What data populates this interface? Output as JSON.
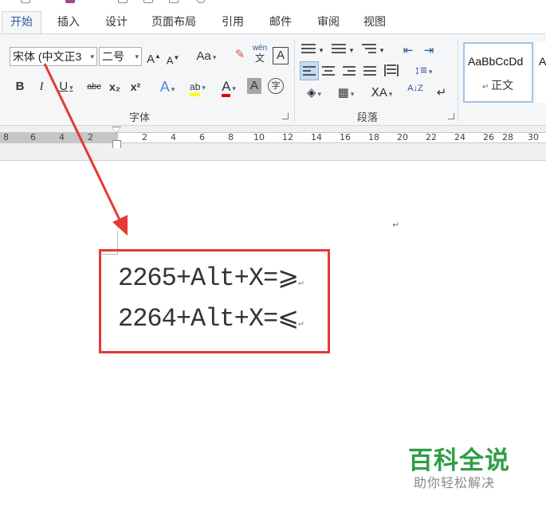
{
  "tabs": [
    {
      "label": "开始",
      "active": true
    },
    {
      "label": "插入"
    },
    {
      "label": "设计"
    },
    {
      "label": "页面布局"
    },
    {
      "label": "引用"
    },
    {
      "label": "邮件"
    },
    {
      "label": "审阅"
    },
    {
      "label": "视图"
    }
  ],
  "font": {
    "name": "宋体 (中文正3",
    "size": "二号",
    "grow_label": "A",
    "shrink_label": "A",
    "case_label": "Aa",
    "phonetic_top": "wén",
    "phonetic_bottom": "文",
    "border_char_label": "A",
    "bold_label": "B",
    "italic_label": "I",
    "underline_label": "U",
    "strike_label": "abc",
    "sub_label": "x₂",
    "sup_label": "x²",
    "effects_label": "A",
    "highlight_label": "ab",
    "color_label": "A",
    "shading_label": "A",
    "enclose_label": "字",
    "group_label": "字体"
  },
  "paragraph": {
    "group_label": "段落",
    "sort_label": "A↓Z"
  },
  "styles": {
    "sample_text": "AaBbCcDd",
    "normal_label": "正文",
    "next_sample": "A"
  },
  "ruler": {
    "ticks": [
      "8",
      "6",
      "4",
      "2",
      "2",
      "4",
      "6",
      "8",
      "10",
      "12",
      "14",
      "16",
      "18",
      "20",
      "22",
      "24",
      "26",
      "28",
      "30"
    ]
  },
  "document": {
    "lines": [
      "2265+Alt+X=⩾",
      "2264+Alt+X=⩽"
    ],
    "paragraph_mark": "↵"
  },
  "colors": {
    "accent": "#2b579a",
    "annotation": "#e53935",
    "highlight": "#ffff00",
    "font_color": "#e00000",
    "watermark": "#2e9e44"
  },
  "watermark": {
    "title": "百科全说",
    "subtitle": "助你轻松解决"
  }
}
